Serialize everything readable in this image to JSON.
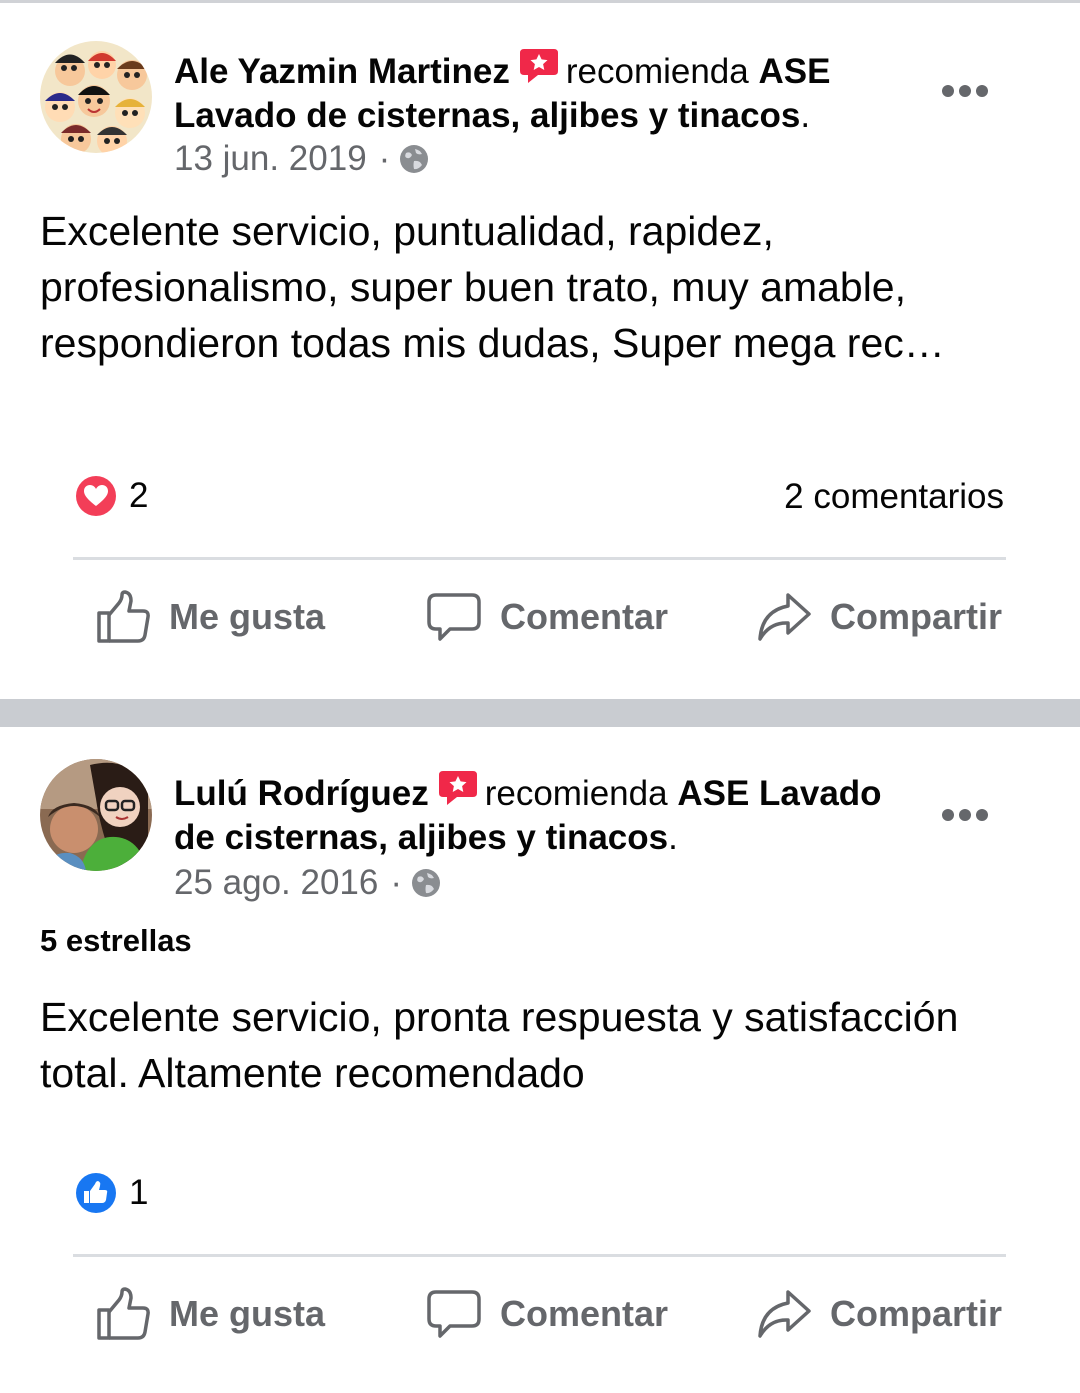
{
  "posts": [
    {
      "author": "Ale Yazmin Martinez",
      "verb": "recomienda",
      "page": "ASE Lavado de cisternas, aljibes y tinacos",
      "page_suffix": ".",
      "date": "13 jun. 2019",
      "date_sep": "·",
      "rating": "",
      "body": "Excelente servicio, puntualidad, rapidez, profesionalismo, super buen trato, muy amable, respondieron todas mis dudas, Super mega rec…",
      "reaction_type": "love",
      "reaction_count": "2",
      "comments": "2 comentarios"
    },
    {
      "author": "Lulú Rodríguez",
      "verb": "recomienda",
      "page": "ASE Lavado de cisternas, aljibes y tinacos",
      "page_suffix": ".",
      "date": "25 ago. 2016",
      "date_sep": "·",
      "rating": "5 estrellas",
      "body": "Excelente servicio, pronta respuesta y satisfacción total. Altamente recomendado",
      "reaction_type": "like",
      "reaction_count": "1",
      "comments": ""
    }
  ],
  "actions": {
    "like": "Me gusta",
    "comment": "Comentar",
    "share": "Compartir"
  },
  "colors": {
    "text": "#050505",
    "secondary": "#65676b",
    "love": "#f33e58",
    "like": "#1877f2",
    "separator": "#c9ccd1"
  },
  "icons": [
    "recommend-icon",
    "globe-icon",
    "more-icon",
    "love-reaction-icon",
    "like-reaction-icon",
    "thumbs-up-icon",
    "comment-bubble-icon",
    "share-arrow-icon"
  ]
}
